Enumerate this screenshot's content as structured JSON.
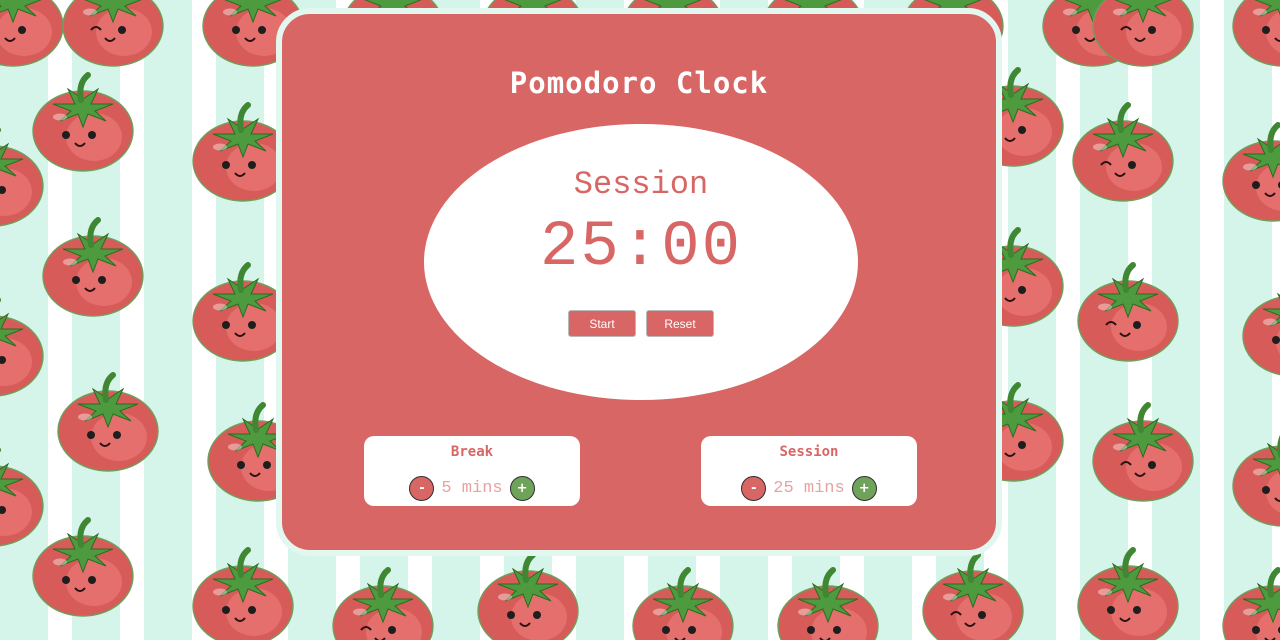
{
  "app": {
    "title": "Pomodoro Clock"
  },
  "timer": {
    "label": "Session",
    "time": "25:00",
    "start_label": "Start",
    "reset_label": "Reset"
  },
  "break_setting": {
    "title": "Break",
    "value": "5 mins",
    "decrement_label": "-",
    "increment_label": "+"
  },
  "session_setting": {
    "title": "Session",
    "value": "25 mins",
    "decrement_label": "-",
    "increment_label": "+"
  },
  "theme": {
    "panel_color": "#d76664",
    "accent_green": "#6fa35a",
    "stripe_color": "#d6f5ea",
    "background_pattern": "kawaii-tomato-icon"
  }
}
